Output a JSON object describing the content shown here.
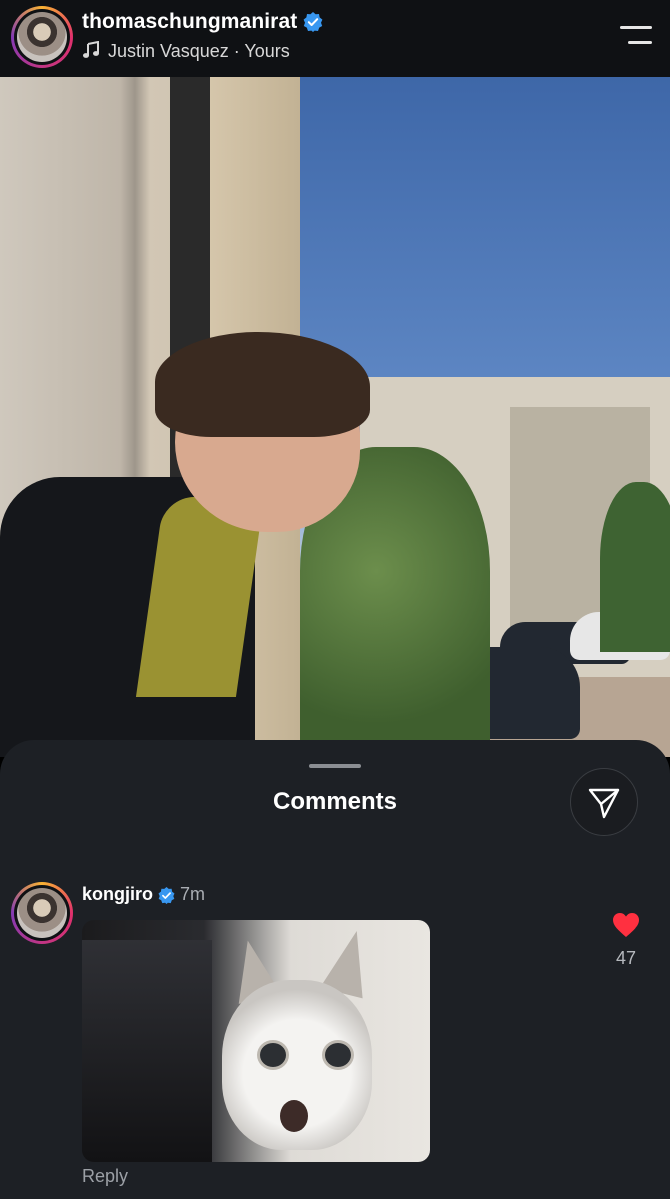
{
  "header": {
    "username": "thomaschungmanirat",
    "verified": true,
    "song": "Justin Vasquez · Yours",
    "menu_icon": "hamburger-menu-icon"
  },
  "photo": {
    "description_icon": "post-photo"
  },
  "comments_sheet": {
    "title": "Comments",
    "share_icon": "send-icon",
    "comments": [
      {
        "username": "kongjiro",
        "verified": true,
        "time": "7m",
        "media": "gif-surprised-cat",
        "likes": "47",
        "liked": true,
        "reply_label": "Reply"
      }
    ]
  },
  "colors": {
    "background": "#0f1114",
    "sheet": "#1d2025",
    "verified_blue": "#3897f0",
    "like_red": "#ff3040"
  }
}
